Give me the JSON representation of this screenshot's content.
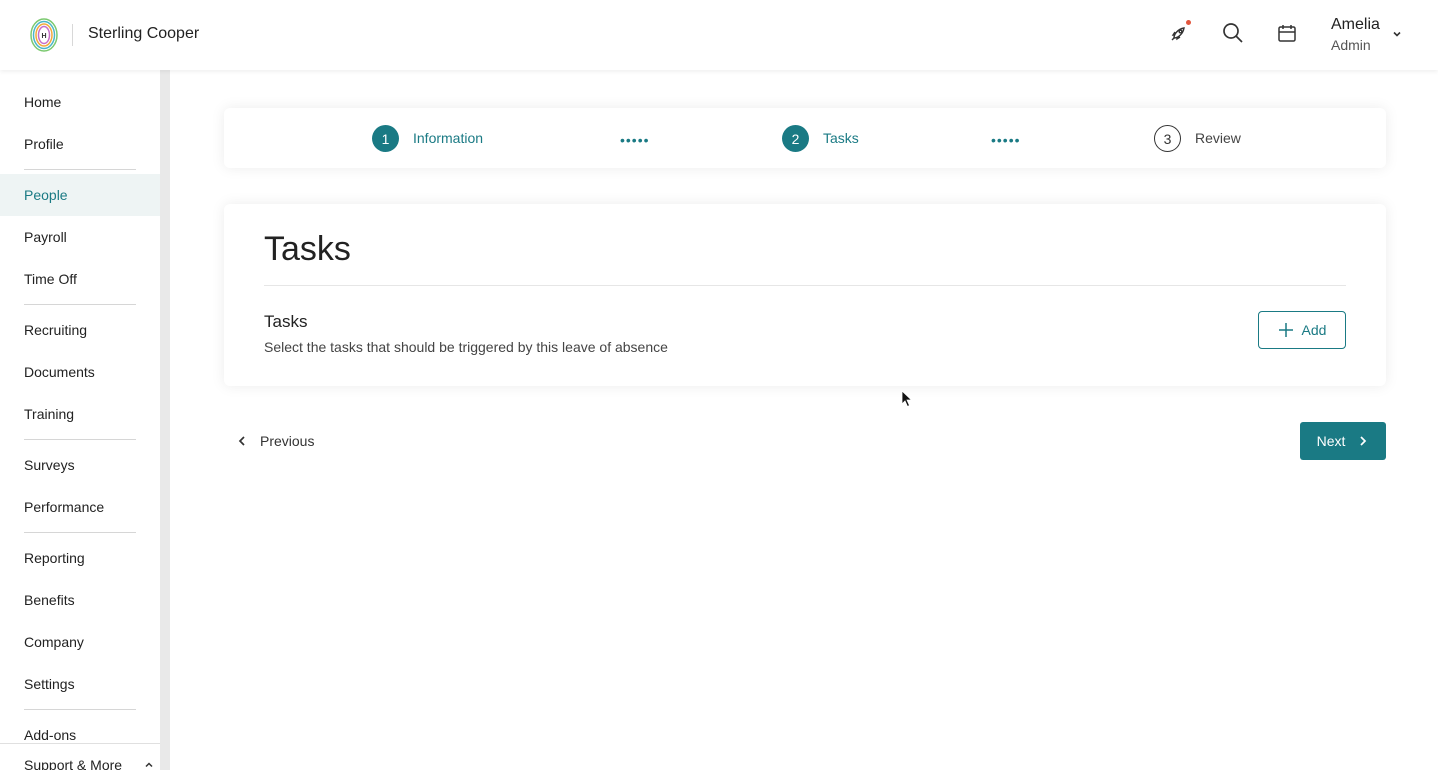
{
  "header": {
    "company_name": "Sterling Cooper",
    "user": {
      "name": "Amelia",
      "role": "Admin"
    },
    "icons": [
      "rocket-icon",
      "search-icon",
      "calendar-icon",
      "chevron-down-icon"
    ],
    "notification_color": "#e2553c"
  },
  "sidebar": {
    "items": [
      {
        "label": "Home"
      },
      {
        "label": "Profile"
      },
      {
        "label": "People",
        "active": true
      },
      {
        "label": "Payroll"
      },
      {
        "label": "Time Off"
      },
      {
        "label": "Recruiting"
      },
      {
        "label": "Documents"
      },
      {
        "label": "Training"
      },
      {
        "label": "Surveys"
      },
      {
        "label": "Performance"
      },
      {
        "label": "Reporting"
      },
      {
        "label": "Benefits"
      },
      {
        "label": "Company"
      },
      {
        "label": "Settings"
      },
      {
        "label": "Add-ons"
      }
    ],
    "support_label": "Support & More"
  },
  "stepper": {
    "steps": [
      {
        "number": "1",
        "label": "Information",
        "state": "complete"
      },
      {
        "number": "2",
        "label": "Tasks",
        "state": "current"
      },
      {
        "number": "3",
        "label": "Review",
        "state": "upcoming"
      }
    ],
    "connector": "•••••"
  },
  "tasks_card": {
    "title": "Tasks",
    "section_title": "Tasks",
    "section_description": "Select the tasks that should be triggered by this leave of absence",
    "add_label": "Add"
  },
  "footer_nav": {
    "previous_label": "Previous",
    "next_label": "Next"
  },
  "colors": {
    "accent": "#1a7a84",
    "active_nav_bg": "#eef4f4"
  }
}
